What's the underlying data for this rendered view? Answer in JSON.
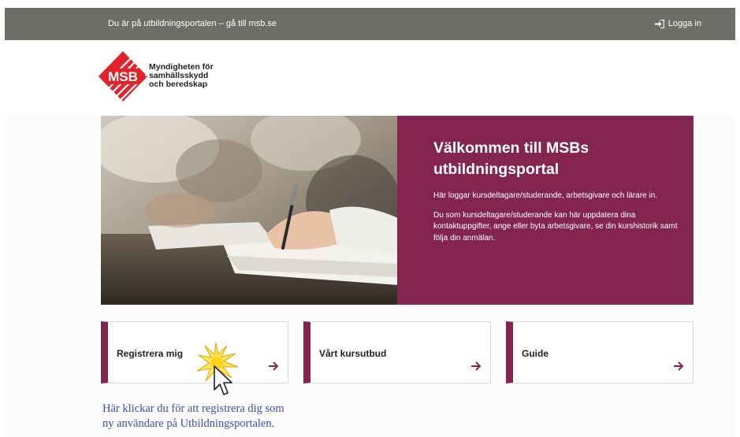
{
  "topbar": {
    "portal_link": "Du är på utbildningsportalen – gå till msb.se",
    "login_label": "Logga in"
  },
  "logo": {
    "mark_text": "MSB",
    "name_lines": [
      "Myndigheten för",
      "samhällsskydd",
      "och beredskap"
    ]
  },
  "hero": {
    "title_line1": "Välkommen till MSBs",
    "title_line2": "utbildningsportal",
    "paragraph1": "Här loggar kursdeltagare/studerande, arbetsgivare och lärare in.",
    "paragraph2": "Du som kursdeltagare/studerande kan här uppdatera dina kontaktuppgifter, ange eller byta arbetsgivare, se din kurshistorik samt följa din anmälan."
  },
  "cards": [
    {
      "label": "Registrera mig"
    },
    {
      "label": "Vårt kursutbud"
    },
    {
      "label": "Guide"
    }
  ],
  "annotation": {
    "line1": "Här klickar du för att registrera dig som",
    "line2": "ny användare på Utbildningsportalen."
  },
  "colors": {
    "accent": "#84254f",
    "topbar": "#6f6d67",
    "logo_red": "#e3232b",
    "annotation": "#3b4fb3"
  }
}
